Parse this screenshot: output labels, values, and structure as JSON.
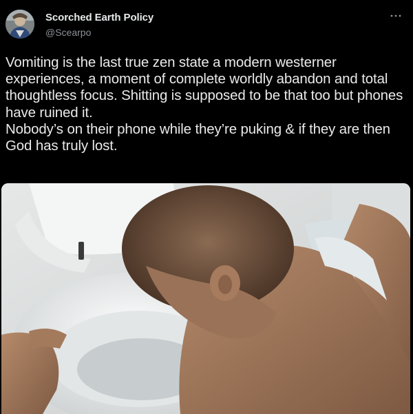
{
  "author": {
    "display_name": "Scorched Earth Policy",
    "handle": "@Scearpo",
    "avatar_icon": "profile-avatar"
  },
  "menu": {
    "icon": "more-options-icon"
  },
  "tweet": {
    "lines": [
      "Vomiting is the last true zen state a modern westerner experiences, a moment of complete worldly abandon and total thoughtless focus. Shitting is supposed to be that too but phones have ruined it.",
      "Nobody’s on their phone while they’re puking & if they are then God has truly lost."
    ]
  },
  "media": {
    "type": "photo"
  },
  "colors": {
    "background": "#000000",
    "text": "#e7e9ea",
    "secondary_text": "#8b9298"
  }
}
